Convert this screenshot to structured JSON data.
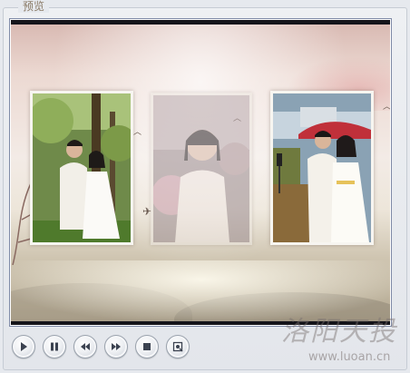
{
  "panel": {
    "title": "预览"
  },
  "preview": {
    "photos": [
      {
        "name": "photo-left",
        "subject": "couple in garden"
      },
      {
        "name": "photo-middle",
        "subject": "bride portrait (fading)"
      },
      {
        "name": "photo-right",
        "subject": "couple under red umbrella"
      }
    ]
  },
  "controls": [
    {
      "name": "play-button",
      "icon": "play-icon"
    },
    {
      "name": "pause-button",
      "icon": "pause-icon"
    },
    {
      "name": "rewind-button",
      "icon": "rewind-icon"
    },
    {
      "name": "fast-forward-button",
      "icon": "fast-forward-icon"
    },
    {
      "name": "stop-button",
      "icon": "stop-icon"
    },
    {
      "name": "snapshot-button",
      "icon": "snapshot-icon"
    }
  ],
  "watermark": {
    "text": "洛阳天投",
    "url": "www.luoan.cn"
  }
}
